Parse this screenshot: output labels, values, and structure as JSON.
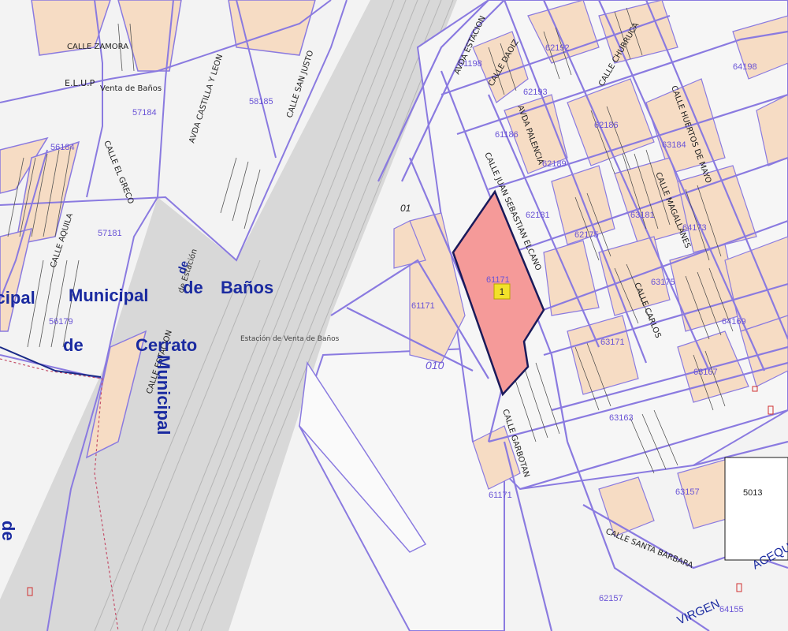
{
  "colors": {
    "background": "#f3f3f3",
    "parcel_line": "#8a7ae0",
    "parcel_fill_building": "#f6dcc4",
    "rail_area": "#d6d6d6",
    "highlight_fill": "#f59a99",
    "highlight_stroke": "#1a1a5a",
    "marker_fill": "#f2e12a",
    "parcel_number": "#6a54d6",
    "big_label": "#1a2aa0"
  },
  "icons": [
    "parcel-marker-icon"
  ],
  "street_names": {
    "calle_zamora": "CALLE ZAMORA",
    "avda_castilla_leon": "AVDA CASTILLA Y LEON",
    "calle_san_justo": "CALLE SAN JUSTO",
    "avda_estacion": "AVDA ESTACION",
    "calle_daoiz": "CALLE DAOIZ",
    "calle_churruca": "CALLE CHURRUCA",
    "calle_huertos": "CALLE HUERTOS DE MAYO",
    "avda_palencia": "AVDA PALENCIA",
    "calle_juan_sebastian": "CALLE JUAN SEBASTIAN ELCANO",
    "calle_magallanes": "CALLE MAGALLANES",
    "calle_carlos": "CALLE CARLOS",
    "calle_aquila": "CALLE AQUILA",
    "calle_el_greco": "CALLE EL GRECO",
    "calle_estacion_west": "CALLE ESTACION",
    "calle_santa_barbara": "CALLE SANTA BARBARA",
    "calle_garbotan": "CALLE GARBOTAN",
    "acequia": "ACEQU",
    "virgen": "VIRGEN",
    "de_vert": "de",
    "de_est": "de Estación"
  },
  "place_labels": {
    "elup": "E.L.U.P",
    "venta_de_banos": "Venta de Baños",
    "estacion": "Estación de Venta de Baños",
    "municipal": "Municipal",
    "de": "de",
    "banos": "Baños",
    "de2": "de",
    "cerrato": "Cerrato",
    "municipal_vert": "Municipal",
    "municipal_left": "nicipal",
    "de_left": "de"
  },
  "parcel_numbers": {
    "p58185": "58185",
    "p57184": "57184",
    "p56184": "56184",
    "p57181": "57181",
    "p56179": "56179",
    "p61198": "61198",
    "p62193": "62193",
    "p62192": "62192",
    "p62186": "62186",
    "p64198": "64198",
    "p61186": "61186",
    "p62189": "62189",
    "p63184": "63184",
    "p62181": "62181",
    "p62175": "62175",
    "p63181": "63181",
    "p64173": "64173",
    "p61171_main": "61171",
    "p61171_high": "61171",
    "p63175": "63175",
    "p64169": "64169",
    "p63171": "63171",
    "p63167": "63167",
    "p63163": "63163",
    "p61171_low": "61171",
    "p63157": "63157",
    "p5013": "5013",
    "p62157": "62157",
    "p64155": "64155",
    "p01": "01",
    "p010": "010"
  },
  "marker": {
    "label": "1"
  }
}
